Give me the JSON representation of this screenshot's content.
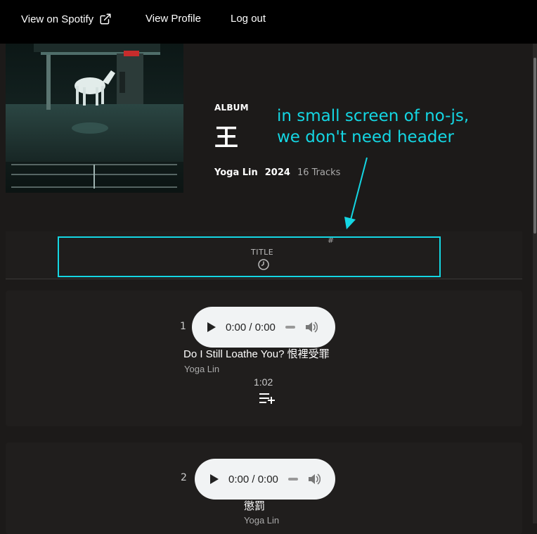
{
  "nav": {
    "spotify": "View on Spotify",
    "profile": "View Profile",
    "logout": "Log out"
  },
  "album": {
    "label": "ALBUM",
    "title": "王",
    "artist": "Yoga Lin",
    "year": "2024",
    "tracks": "16 Tracks"
  },
  "annotation": {
    "line1": "in small screen of no-js,",
    "line2": "we don't need header"
  },
  "table_header": {
    "hash": "#",
    "title": "TITLE"
  },
  "tracks": [
    {
      "number": "1",
      "time": "0:00 / 0:00",
      "title": "Do I Still Loathe You? 恨裡受罪",
      "artist": "Yoga Lin",
      "duration": "1:02"
    },
    {
      "number": "2",
      "time": "0:00 / 0:00",
      "title": "懲罰",
      "artist": "Yoga Lin"
    }
  ],
  "colors": {
    "accent": "#14d6e3",
    "background": "#1c1a19",
    "topbar": "#000000"
  }
}
